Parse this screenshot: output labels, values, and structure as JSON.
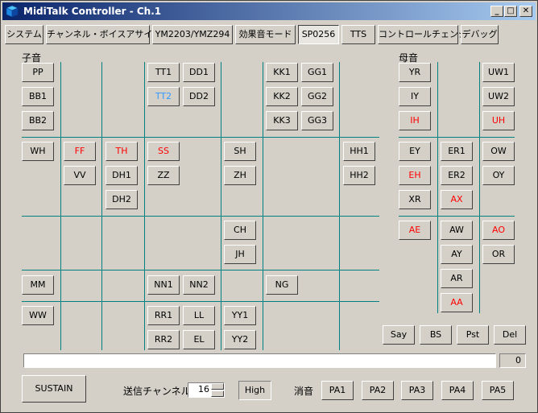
{
  "window": {
    "title": "MidiTalk Controller - Ch.1",
    "min_glyph": "_",
    "max_glyph": "□",
    "close_glyph": "✕"
  },
  "tabs": [
    "システム",
    "チャンネル・ボイスアサイン",
    "YM2203/YMZ294",
    "効果音モード",
    "SP0256",
    "TTS",
    "コントロールチェンジ",
    "デバッグ"
  ],
  "active_tab": "SP0256",
  "consonants": {
    "header": "子音",
    "buttons": [
      "PP",
      "BB1",
      "BB2",
      "TT1",
      "TT2",
      "DD1",
      "DD2",
      "KK1",
      "KK2",
      "KK3",
      "GG1",
      "GG2",
      "GG3",
      "WH",
      "FF",
      "VV",
      "TH",
      "DH1",
      "DH2",
      "SS",
      "ZZ",
      "SH",
      "ZH",
      "HH1",
      "HH2",
      "CH",
      "JH",
      "MM",
      "NN1",
      "NN2",
      "NG",
      "WW",
      "RR1",
      "RR2",
      "LL",
      "EL",
      "YY1",
      "YY2"
    ]
  },
  "vowels": {
    "header": "母音",
    "buttons": [
      "YR",
      "IY",
      "IH",
      "UW1",
      "UW2",
      "UH",
      "EY",
      "EH",
      "XR",
      "ER1",
      "ER2",
      "AX",
      "OW",
      "OY",
      "AE",
      "AW",
      "AY",
      "AR",
      "AA",
      "AO",
      "OR"
    ]
  },
  "actions": [
    "Say",
    "BS",
    "Pst",
    "Del"
  ],
  "progress": {
    "value": 0,
    "counter": "0"
  },
  "bottom": {
    "sustain": "SUSTAIN",
    "channel_label": "送信チャンネル",
    "channel_value": "16",
    "high": "High",
    "mute_label": "消音",
    "pa": [
      "PA1",
      "PA2",
      "PA3",
      "PA4",
      "PA5"
    ]
  },
  "colors": {
    "red": "#ff0000",
    "blue": "#3399ff",
    "title_start": "#0a246a",
    "title_end": "#a6caf0",
    "grid": "#008080"
  }
}
